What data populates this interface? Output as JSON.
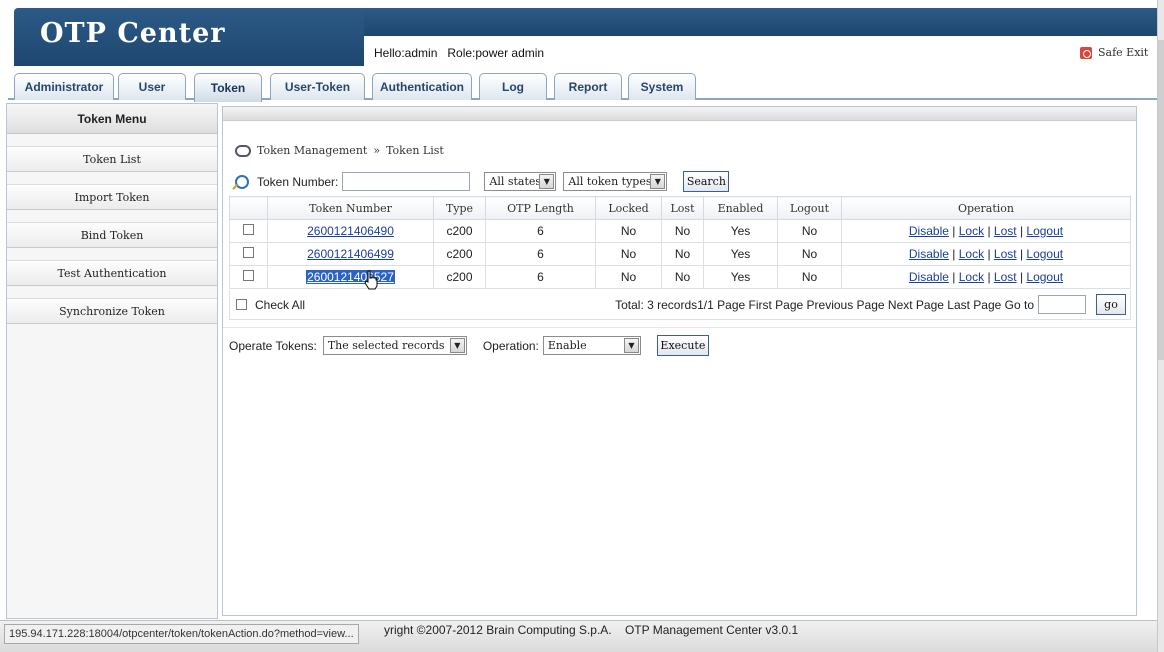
{
  "app": {
    "title": "OTP Center",
    "hello": "Hello:admin   Role:power admin",
    "safe_exit": "Safe Exit"
  },
  "tabs": [
    {
      "label": "Administrator"
    },
    {
      "label": "User"
    },
    {
      "label": "Token",
      "active": true
    },
    {
      "label": "User-Token"
    },
    {
      "label": "Authentication"
    },
    {
      "label": "Log"
    },
    {
      "label": "Report"
    },
    {
      "label": "System"
    }
  ],
  "sidebar": {
    "title": "Token Menu",
    "items": [
      {
        "label": "Token List"
      },
      {
        "label": "Import Token"
      },
      {
        "label": "Bind Token"
      },
      {
        "label": "Test Authentication"
      },
      {
        "label": "Synchronize Token"
      }
    ]
  },
  "breadcrumb": {
    "part1": "Token Management",
    "separator": "»",
    "part2": "Token List"
  },
  "filters": {
    "token_number_label": "Token Number:",
    "token_number_value": "",
    "state_select": "All states",
    "type_select": "All token types",
    "search_button": "Search"
  },
  "table": {
    "columns": [
      "Token Number",
      "Type",
      "OTP Length",
      "Locked",
      "Lost",
      "Enabled",
      "Logout",
      "Operation"
    ],
    "rows": [
      {
        "token": "2600121406490",
        "type": "c200",
        "otp_length": "6",
        "locked": "No",
        "lost": "No",
        "enabled": "Yes",
        "logout": "No"
      },
      {
        "token": "2600121406499",
        "type": "c200",
        "otp_length": "6",
        "locked": "No",
        "lost": "No",
        "enabled": "Yes",
        "logout": "No"
      },
      {
        "token": "2600121406527",
        "type": "c200",
        "otp_length": "6",
        "locked": "No",
        "lost": "No",
        "enabled": "Yes",
        "logout": "No"
      }
    ],
    "operations": {
      "disable": "Disable",
      "lock": "Lock",
      "lost": "Lost",
      "logout": "Logout",
      "sep": "|"
    }
  },
  "pager": {
    "check_all": "Check All",
    "summary": "Total: 3 records1/1 Page First Page Previous Page Next Page Last Page Go to",
    "go_value": "",
    "go_button": "go"
  },
  "operate": {
    "label": "Operate Tokens:",
    "select": "The selected records",
    "operation_label": "Operation:",
    "operation_select": "Enable",
    "execute_button": "Execute"
  },
  "status": {
    "url": "195.94.171.228:18004/otpcenter/token/tokenAction.do?method=view...",
    "copyright": "yright ©2007-2012 Brain Computing S.p.A.    OTP Management Center v3.0.1"
  }
}
